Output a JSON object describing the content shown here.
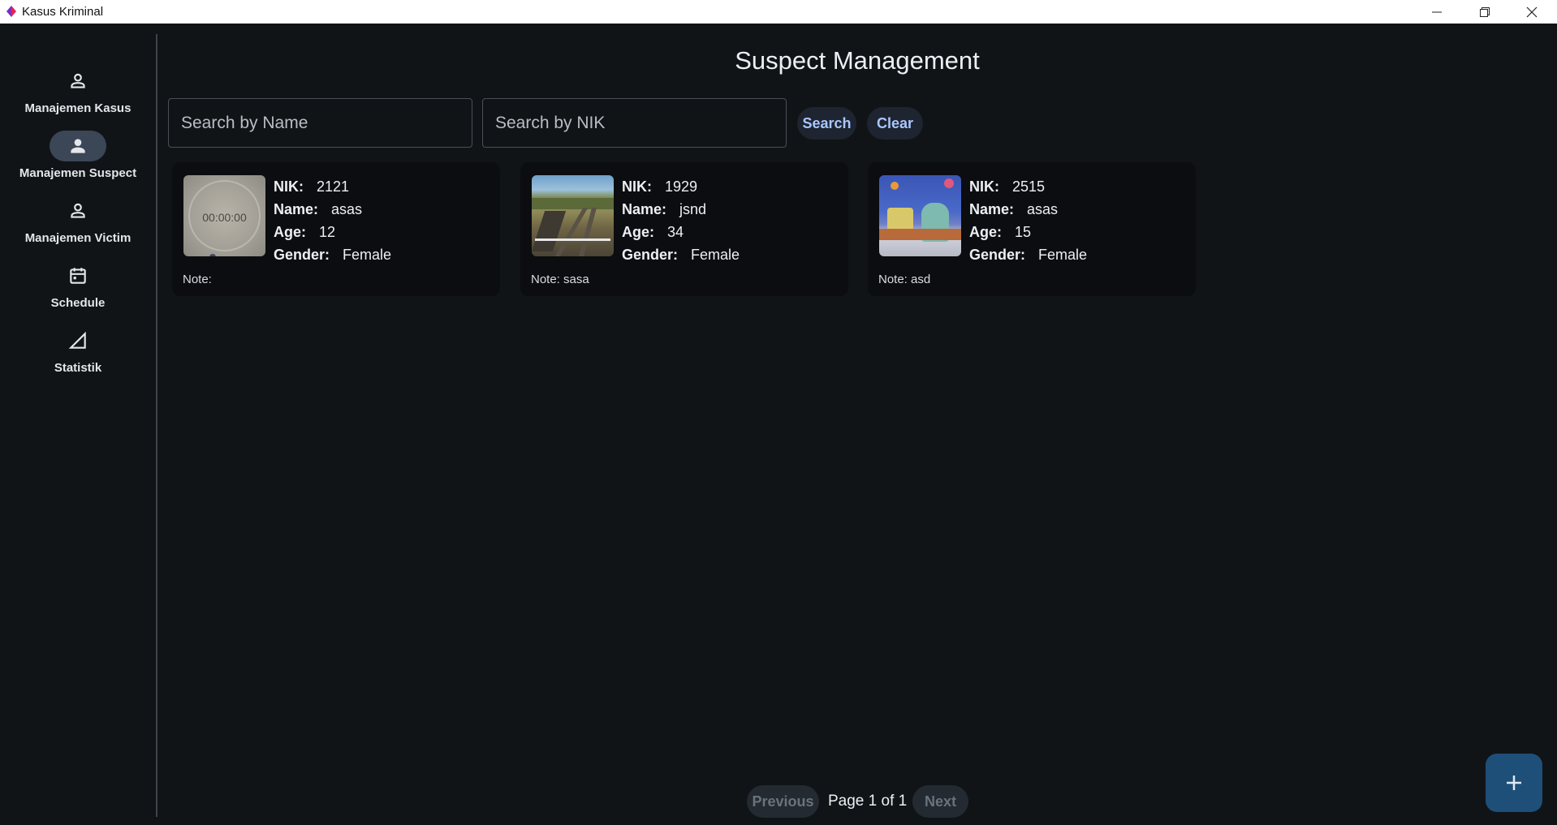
{
  "window": {
    "title": "Kasus Kriminal"
  },
  "sidebar": {
    "items": [
      {
        "label": "Manajemen Kasus",
        "icon": "person-icon",
        "active": false
      },
      {
        "label": "Manajemen Suspect",
        "icon": "person-icon",
        "active": true
      },
      {
        "label": "Manajemen Victim",
        "icon": "person-icon",
        "active": false
      },
      {
        "label": "Schedule",
        "icon": "calendar-icon",
        "active": false
      },
      {
        "label": "Statistik",
        "icon": "signal-triangle-icon",
        "active": false
      }
    ]
  },
  "main": {
    "title": "Suspect Management",
    "search": {
      "name_placeholder": "Search by Name",
      "nik_placeholder": "Search by NIK",
      "search_label": "Search",
      "clear_label": "Clear"
    },
    "field_labels": {
      "nik": "NIK:",
      "name": "Name:",
      "age": "Age:",
      "gender": "Gender:"
    },
    "suspects": [
      {
        "nik": "2121",
        "name": "asas",
        "age": "12",
        "gender": "Female",
        "note": "Note:",
        "photo_text": "00:00:00"
      },
      {
        "nik": "1929",
        "name": "jsnd",
        "age": "34",
        "gender": "Female",
        "note": "Note: sasa"
      },
      {
        "nik": "2515",
        "name": "asas",
        "age": "15",
        "gender": "Female",
        "note": "Note: asd"
      }
    ],
    "pagination": {
      "previous_label": "Previous",
      "page_info": "Page 1 of 1",
      "next_label": "Next"
    }
  },
  "colors": {
    "background": "#111417",
    "accent": "#a9c7ff",
    "fab": "#1e4f78",
    "active_nav": "#3b4756"
  }
}
